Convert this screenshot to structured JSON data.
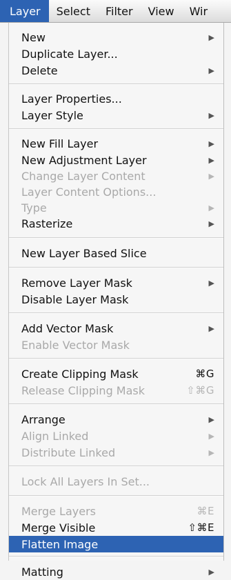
{
  "menubar": {
    "items": [
      "Layer",
      "Select",
      "Filter",
      "View",
      "Wir"
    ]
  },
  "menu": {
    "submenu_glyph": "▶",
    "items": [
      {
        "label": "New",
        "submenu": true
      },
      {
        "label": "Duplicate Layer..."
      },
      {
        "label": "Delete",
        "submenu": true
      },
      {
        "label": "Layer Properties..."
      },
      {
        "label": "Layer Style",
        "submenu": true
      },
      {
        "label": "New Fill Layer",
        "submenu": true
      },
      {
        "label": "New Adjustment Layer",
        "submenu": true
      },
      {
        "label": "Change Layer Content",
        "submenu": true,
        "disabled": true
      },
      {
        "label": "Layer Content Options...",
        "disabled": true
      },
      {
        "label": "Type",
        "submenu": true,
        "disabled": true
      },
      {
        "label": "Rasterize",
        "submenu": true
      },
      {
        "label": "New Layer Based Slice"
      },
      {
        "label": "Remove Layer Mask",
        "submenu": true
      },
      {
        "label": "Disable Layer Mask"
      },
      {
        "label": "Add Vector Mask",
        "submenu": true
      },
      {
        "label": "Enable Vector Mask",
        "disabled": true
      },
      {
        "label": "Create Clipping Mask",
        "shortcut": "⌘G"
      },
      {
        "label": "Release Clipping Mask",
        "shortcut": "⇧⌘G",
        "disabled": true
      },
      {
        "label": "Arrange",
        "submenu": true
      },
      {
        "label": "Align Linked",
        "submenu": true,
        "disabled": true
      },
      {
        "label": "Distribute Linked",
        "submenu": true,
        "disabled": true
      },
      {
        "label": "Lock All Layers In Set...",
        "disabled": true
      },
      {
        "label": "Merge Layers",
        "shortcut": "⌘E",
        "disabled": true
      },
      {
        "label": "Merge Visible",
        "shortcut": "⇧⌘E"
      },
      {
        "label": "Flatten Image",
        "selected": true
      },
      {
        "label": "Matting",
        "submenu": true
      }
    ]
  }
}
